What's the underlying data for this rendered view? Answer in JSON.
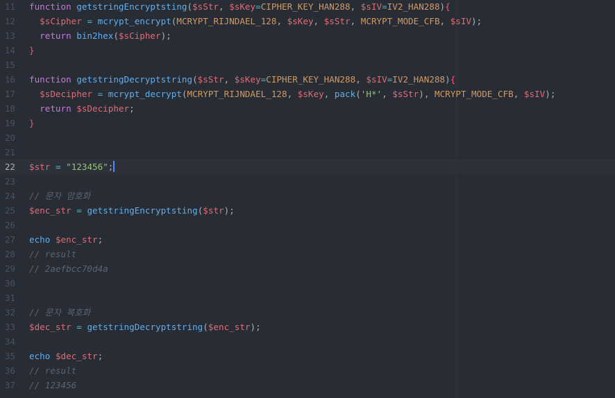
{
  "editor": {
    "cursor_line": 22,
    "lines": [
      {
        "number": "11",
        "tokens": [
          {
            "t": "function",
            "c": "kw"
          },
          {
            "t": " ",
            "c": "pn"
          },
          {
            "t": "getstringEncryptsting",
            "c": "fn"
          },
          {
            "t": "(",
            "c": "pn"
          },
          {
            "t": "$sStr",
            "c": "var"
          },
          {
            "t": ", ",
            "c": "pn"
          },
          {
            "t": "$sKey",
            "c": "var"
          },
          {
            "t": "=",
            "c": "op"
          },
          {
            "t": "CIPHER_KEY_HAN288",
            "c": "cst"
          },
          {
            "t": ", ",
            "c": "pn"
          },
          {
            "t": "$sIV",
            "c": "var"
          },
          {
            "t": "=",
            "c": "op"
          },
          {
            "t": "IV2_HAN288",
            "c": "cst"
          },
          {
            "t": ")",
            "c": "pn"
          },
          {
            "t": "{",
            "c": "br"
          }
        ]
      },
      {
        "number": "12",
        "tokens": [
          {
            "t": "  ",
            "c": "pn"
          },
          {
            "t": "$sCipher",
            "c": "var"
          },
          {
            "t": " ",
            "c": "pn"
          },
          {
            "t": "=",
            "c": "op"
          },
          {
            "t": " ",
            "c": "pn"
          },
          {
            "t": "mcrypt_encrypt",
            "c": "fn"
          },
          {
            "t": "(",
            "c": "pn"
          },
          {
            "t": "MCRYPT_RIJNDAEL_128",
            "c": "cst"
          },
          {
            "t": ", ",
            "c": "pn"
          },
          {
            "t": "$sKey",
            "c": "var"
          },
          {
            "t": ", ",
            "c": "pn"
          },
          {
            "t": "$sStr",
            "c": "var"
          },
          {
            "t": ", ",
            "c": "pn"
          },
          {
            "t": "MCRYPT_MODE_CFB",
            "c": "cst"
          },
          {
            "t": ", ",
            "c": "pn"
          },
          {
            "t": "$sIV",
            "c": "var"
          },
          {
            "t": ");",
            "c": "pn"
          }
        ]
      },
      {
        "number": "13",
        "tokens": [
          {
            "t": "  ",
            "c": "pn"
          },
          {
            "t": "return",
            "c": "kw"
          },
          {
            "t": " ",
            "c": "pn"
          },
          {
            "t": "bin2hex",
            "c": "fn"
          },
          {
            "t": "(",
            "c": "pn"
          },
          {
            "t": "$sCipher",
            "c": "var"
          },
          {
            "t": ");",
            "c": "pn"
          }
        ]
      },
      {
        "number": "14",
        "tokens": [
          {
            "t": "}",
            "c": "br"
          }
        ]
      },
      {
        "number": "15",
        "tokens": []
      },
      {
        "number": "16",
        "tokens": [
          {
            "t": "function",
            "c": "kw"
          },
          {
            "t": " ",
            "c": "pn"
          },
          {
            "t": "getstringDecryptstring",
            "c": "fn"
          },
          {
            "t": "(",
            "c": "pn"
          },
          {
            "t": "$sStr",
            "c": "var"
          },
          {
            "t": ", ",
            "c": "pn"
          },
          {
            "t": "$sKey",
            "c": "var"
          },
          {
            "t": "=",
            "c": "op"
          },
          {
            "t": "CIPHER_KEY_HAN288",
            "c": "cst"
          },
          {
            "t": ", ",
            "c": "pn"
          },
          {
            "t": "$sIV",
            "c": "var"
          },
          {
            "t": "=",
            "c": "op"
          },
          {
            "t": "IV2_HAN288",
            "c": "cst"
          },
          {
            "t": ")",
            "c": "pn"
          },
          {
            "t": "{",
            "c": "br"
          }
        ]
      },
      {
        "number": "17",
        "tokens": [
          {
            "t": "  ",
            "c": "pn"
          },
          {
            "t": "$sDecipher",
            "c": "var"
          },
          {
            "t": " ",
            "c": "pn"
          },
          {
            "t": "=",
            "c": "op"
          },
          {
            "t": " ",
            "c": "pn"
          },
          {
            "t": "mcrypt_decrypt",
            "c": "fn"
          },
          {
            "t": "(",
            "c": "pn"
          },
          {
            "t": "MCRYPT_RIJNDAEL_128",
            "c": "cst"
          },
          {
            "t": ", ",
            "c": "pn"
          },
          {
            "t": "$sKey",
            "c": "var"
          },
          {
            "t": ", ",
            "c": "pn"
          },
          {
            "t": "pack",
            "c": "fn"
          },
          {
            "t": "(",
            "c": "pn"
          },
          {
            "t": "'H*'",
            "c": "str"
          },
          {
            "t": ", ",
            "c": "pn"
          },
          {
            "t": "$sStr",
            "c": "var"
          },
          {
            "t": "), ",
            "c": "pn"
          },
          {
            "t": "MCRYPT_MODE_CFB",
            "c": "cst"
          },
          {
            "t": ", ",
            "c": "pn"
          },
          {
            "t": "$sIV",
            "c": "var"
          },
          {
            "t": ");",
            "c": "pn"
          }
        ]
      },
      {
        "number": "18",
        "tokens": [
          {
            "t": "  ",
            "c": "pn"
          },
          {
            "t": "return",
            "c": "kw"
          },
          {
            "t": " ",
            "c": "pn"
          },
          {
            "t": "$sDecipher",
            "c": "var"
          },
          {
            "t": ";",
            "c": "pn"
          }
        ]
      },
      {
        "number": "19",
        "tokens": [
          {
            "t": "}",
            "c": "br"
          }
        ]
      },
      {
        "number": "20",
        "tokens": []
      },
      {
        "number": "21",
        "tokens": []
      },
      {
        "number": "22",
        "tokens": [
          {
            "t": "$str",
            "c": "var"
          },
          {
            "t": " ",
            "c": "pn"
          },
          {
            "t": "=",
            "c": "op"
          },
          {
            "t": " ",
            "c": "pn"
          },
          {
            "t": "\"123456\"",
            "c": "str"
          },
          {
            "t": ";",
            "c": "pn"
          }
        ]
      },
      {
        "number": "23",
        "tokens": []
      },
      {
        "number": "24",
        "tokens": [
          {
            "t": "// 문자 암호화",
            "c": "cm"
          }
        ]
      },
      {
        "number": "25",
        "tokens": [
          {
            "t": "$enc_str",
            "c": "var"
          },
          {
            "t": " ",
            "c": "pn"
          },
          {
            "t": "=",
            "c": "op"
          },
          {
            "t": " ",
            "c": "pn"
          },
          {
            "t": "getstringEncryptsting",
            "c": "fn"
          },
          {
            "t": "(",
            "c": "pn"
          },
          {
            "t": "$str",
            "c": "var"
          },
          {
            "t": ");",
            "c": "pn"
          }
        ]
      },
      {
        "number": "26",
        "tokens": []
      },
      {
        "number": "27",
        "tokens": [
          {
            "t": "echo",
            "c": "fn"
          },
          {
            "t": " ",
            "c": "pn"
          },
          {
            "t": "$enc_str",
            "c": "var"
          },
          {
            "t": ";",
            "c": "pn"
          }
        ]
      },
      {
        "number": "28",
        "tokens": [
          {
            "t": "// result",
            "c": "cm"
          }
        ]
      },
      {
        "number": "29",
        "tokens": [
          {
            "t": "// 2aefbcc70d4a",
            "c": "cm"
          }
        ]
      },
      {
        "number": "30",
        "tokens": []
      },
      {
        "number": "31",
        "tokens": []
      },
      {
        "number": "32",
        "tokens": [
          {
            "t": "// 문자 복호화",
            "c": "cm"
          }
        ]
      },
      {
        "number": "33",
        "tokens": [
          {
            "t": "$dec_str",
            "c": "var"
          },
          {
            "t": " ",
            "c": "pn"
          },
          {
            "t": "=",
            "c": "op"
          },
          {
            "t": " ",
            "c": "pn"
          },
          {
            "t": "getstringDecryptstring",
            "c": "fn"
          },
          {
            "t": "(",
            "c": "pn"
          },
          {
            "t": "$enc_str",
            "c": "var"
          },
          {
            "t": ");",
            "c": "pn"
          }
        ]
      },
      {
        "number": "34",
        "tokens": []
      },
      {
        "number": "35",
        "tokens": [
          {
            "t": "echo",
            "c": "fn"
          },
          {
            "t": " ",
            "c": "pn"
          },
          {
            "t": "$dec_str",
            "c": "var"
          },
          {
            "t": ";",
            "c": "pn"
          }
        ]
      },
      {
        "number": "36",
        "tokens": [
          {
            "t": "// result",
            "c": "cm"
          }
        ]
      },
      {
        "number": "37",
        "tokens": [
          {
            "t": "// 123456",
            "c": "cm"
          }
        ]
      }
    ]
  }
}
